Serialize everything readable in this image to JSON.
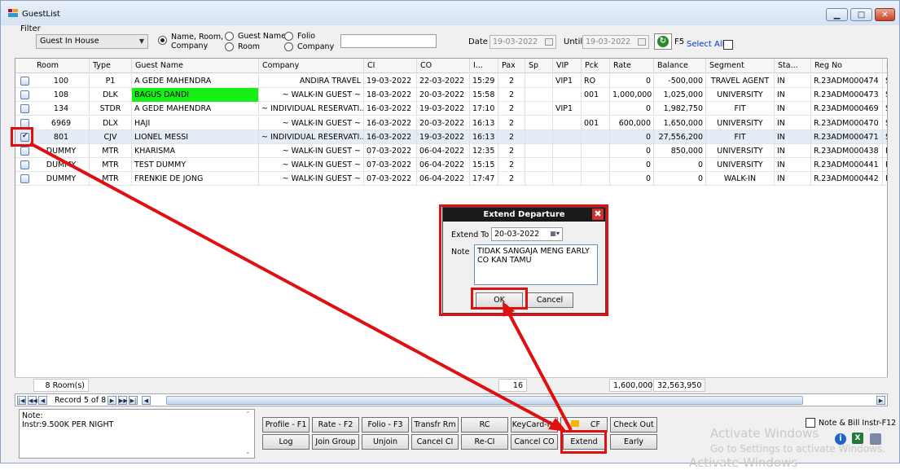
{
  "window": {
    "title": "GuestList"
  },
  "filter": {
    "label": "Filter",
    "status_select": "Guest In House",
    "radio_name_room_company": "Name, Room,\nCompany",
    "radio_name_room_company_l1": "Name, Room,",
    "radio_name_room_company_l2": "Company",
    "radio_guest_name": "Guest Name",
    "radio_room": "Room",
    "radio_folio": "Folio",
    "radio_company": "Company",
    "search_value": "",
    "date_label": "Date",
    "date_value": "19-03-2022",
    "until_label": "Until",
    "until_value": "19-03-2022",
    "refresh_key": "F5",
    "select_all": "Select All"
  },
  "grid": {
    "columns": [
      "Room",
      "Type",
      "Guest Name",
      "Company",
      "CI",
      "CO",
      "I...",
      "Pax",
      "Sp",
      "VIP",
      "Pck",
      "Rate",
      "Balance",
      "Segment",
      "Sta...",
      "Reg No",
      "F"
    ],
    "rows": [
      {
        "room": "100",
        "type": "P1",
        "guest": "A GEDE MAHENDRA",
        "company": "ANDIRA TRAVEL",
        "ci": "19-03-2022",
        "co": "22-03-2022",
        "time": "15:29",
        "pax": "2",
        "sp": "",
        "vip": "VIP1",
        "pck": "RO",
        "rate": "0",
        "balance": "-500,000",
        "segment": "TRAVEL AGENT",
        "status": "IN",
        "regno": "R.23ADM000474",
        "f": "S",
        "checked": false,
        "highlight": false
      },
      {
        "room": "108",
        "type": "DLK",
        "guest": "BAGUS DANDI",
        "company": "~ WALK-IN GUEST ~",
        "ci": "18-03-2022",
        "co": "20-03-2022",
        "time": "15:58",
        "pax": "2",
        "sp": "",
        "vip": "",
        "pck": "001",
        "rate": "1,000,000",
        "balance": "1,025,000",
        "segment": "UNIVERSITY",
        "status": "IN",
        "regno": "R.23ADM000473",
        "f": "S",
        "checked": false,
        "highlight": true
      },
      {
        "room": "134",
        "type": "STDR",
        "guest": "A GEDE MAHENDRA",
        "company": "~ INDIVIDUAL RESERVATI...",
        "ci": "16-03-2022",
        "co": "19-03-2022",
        "time": "17:10",
        "pax": "2",
        "sp": "",
        "vip": "VIP1",
        "pck": "",
        "rate": "0",
        "balance": "1,982,750",
        "segment": "FIT",
        "status": "IN",
        "regno": "R.23ADM000469",
        "f": "S",
        "checked": false,
        "highlight": false
      },
      {
        "room": "6969",
        "type": "DLX",
        "guest": "HAJI",
        "company": "~ WALK-IN GUEST ~",
        "ci": "16-03-2022",
        "co": "20-03-2022",
        "time": "16:13",
        "pax": "2",
        "sp": "",
        "vip": "",
        "pck": "001",
        "rate": "600,000",
        "balance": "1,650,000",
        "segment": "UNIVERSITY",
        "status": "IN",
        "regno": "R.23ADM000470",
        "f": "S",
        "checked": false,
        "highlight": false
      },
      {
        "room": "801",
        "type": "CJV",
        "guest": "LIONEL MESSI",
        "company": "~ INDIVIDUAL RESERVATI...",
        "ci": "16-03-2022",
        "co": "19-03-2022",
        "time": "16:13",
        "pax": "2",
        "sp": "",
        "vip": "",
        "pck": "",
        "rate": "0",
        "balance": "27,556,200",
        "segment": "FIT",
        "status": "IN",
        "regno": "R.23ADM000471",
        "f": "S",
        "checked": true,
        "highlight": false
      },
      {
        "room": "DUMMY",
        "type": "MTR",
        "guest": "KHARISMA",
        "company": "~ WALK-IN GUEST ~",
        "ci": "07-03-2022",
        "co": "06-04-2022",
        "time": "12:35",
        "pax": "2",
        "sp": "",
        "vip": "",
        "pck": "",
        "rate": "0",
        "balance": "850,000",
        "segment": "UNIVERSITY",
        "status": "IN",
        "regno": "R.23ADM000438",
        "f": "R",
        "checked": false,
        "highlight": false
      },
      {
        "room": "DUMMY",
        "type": "MTR",
        "guest": "TEST DUMMY",
        "company": "~ WALK-IN GUEST ~",
        "ci": "07-03-2022",
        "co": "06-04-2022",
        "time": "15:15",
        "pax": "2",
        "sp": "",
        "vip": "",
        "pck": "",
        "rate": "0",
        "balance": "0",
        "segment": "UNIVERSITY",
        "status": "IN",
        "regno": "R.23ADM000441",
        "f": "R",
        "checked": false,
        "highlight": false
      },
      {
        "room": "DUMMY",
        "type": "MTR",
        "guest": "FRENKIE DE JONG",
        "company": "~ WALK-IN GUEST ~",
        "ci": "07-03-2022",
        "co": "06-04-2022",
        "time": "17:47",
        "pax": "2",
        "sp": "",
        "vip": "",
        "pck": "",
        "rate": "0",
        "balance": "0",
        "segment": "WALK-IN",
        "status": "IN",
        "regno": "R.23ADM000442",
        "f": "R",
        "checked": false,
        "highlight": false
      }
    ],
    "footer": {
      "rooms": "8 Room(s)",
      "pax_total": "16",
      "rate_total": "1,600,000",
      "balance_total": "32,563,950"
    },
    "navigator": {
      "record_text": "Record 5 of 8"
    }
  },
  "note": {
    "label": "Note:",
    "text": "Instr:9.500K PER NIGHT"
  },
  "buttons": {
    "profile": "Profile - F1",
    "rate": "Rate - F2",
    "folio": "Folio - F3",
    "transfer": "Transfr Rm",
    "rc": "RC",
    "keycard": "KeyCard-F4",
    "cf": "CF",
    "checkout": "Check Out",
    "log": "Log",
    "join_group": "Join Group",
    "unjoin": "Unjoin",
    "cancel_ci": "Cancel CI",
    "re_ci": "Re-CI",
    "cancel_co": "Cancel CO",
    "extend": "Extend",
    "early": "Early"
  },
  "note_bill": "Note & Bill Instr-F12",
  "watermark": {
    "line1": "Activate Windows",
    "line2": "Go to Settings to activate Windows.",
    "line3": "Activate Windows"
  },
  "dialog": {
    "title": "Extend Departure",
    "extend_to_label": "Extend To",
    "extend_to_value": "20-03-2022",
    "note_label": "Note",
    "note_line1": "TIDAK SANGAJA MENG EARLY",
    "note_line2": "CO KAN TAMU",
    "ok": "OK",
    "cancel": "Cancel"
  },
  "colors": {
    "annotation": "#e01010",
    "highlight": "#17f017",
    "title_bg": "#1a1a1a"
  }
}
